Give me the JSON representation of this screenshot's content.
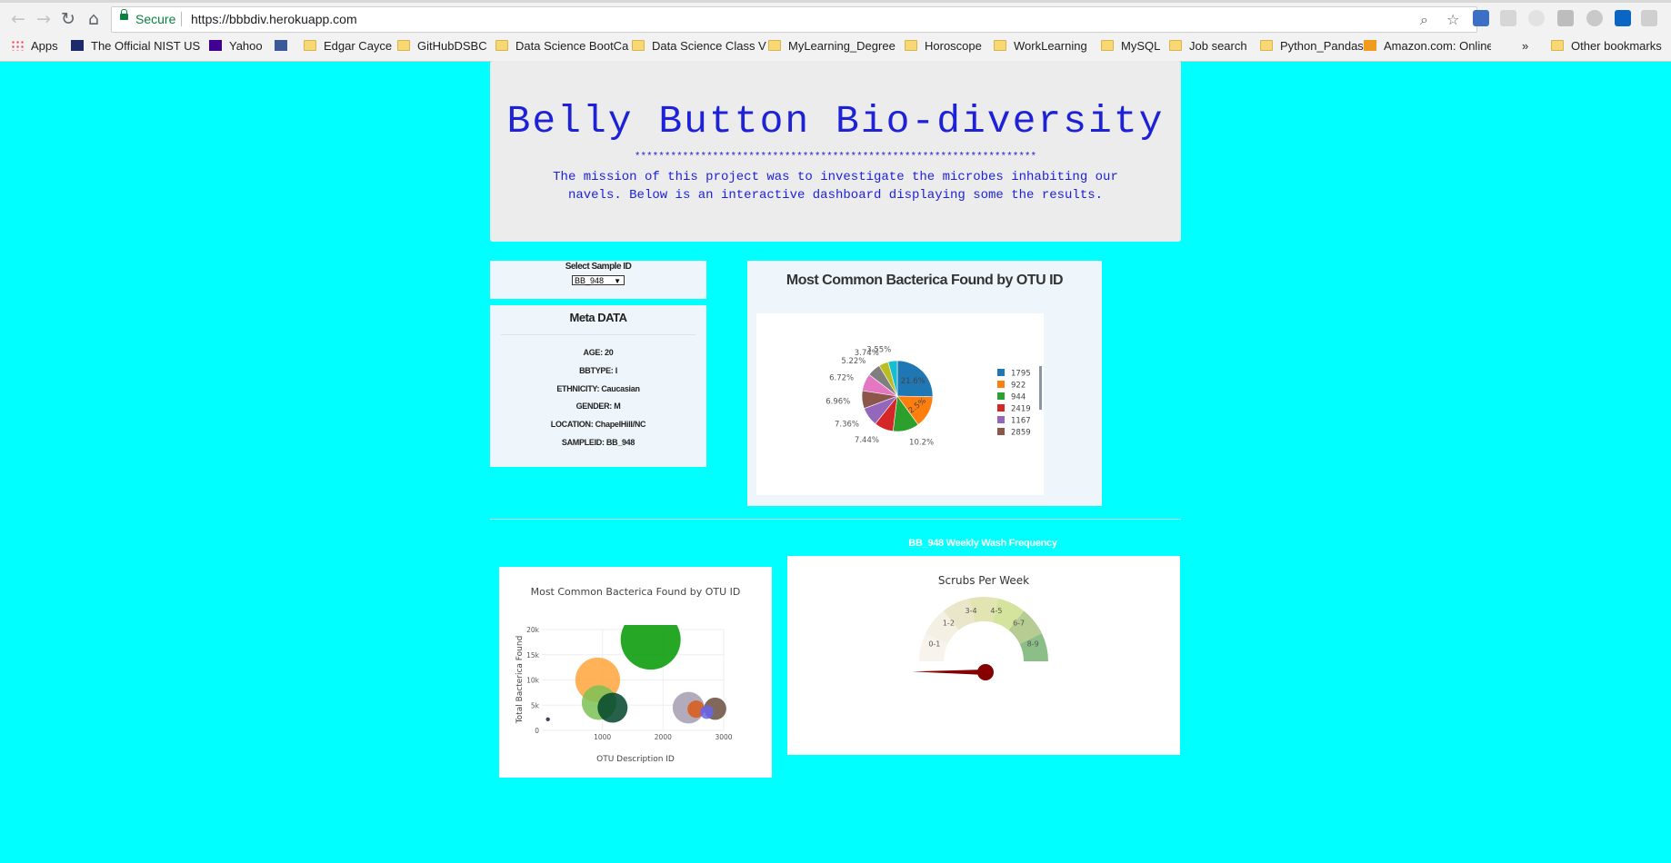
{
  "browser": {
    "secure_label": "Secure",
    "url": "https://bbbdiv.herokuapp.com",
    "bookmarks": [
      {
        "label": "Apps",
        "icon": "apps-grid-icon"
      },
      {
        "label": "The Official NIST US",
        "icon": "nist-icon"
      },
      {
        "label": "Yahoo",
        "icon": "yahoo-icon"
      },
      {
        "label": "",
        "icon": "facebook-icon"
      },
      {
        "label": "Edgar Cayce",
        "icon": "folder-icon"
      },
      {
        "label": "GitHubDSBC",
        "icon": "folder-icon"
      },
      {
        "label": "Data Science BootCa",
        "icon": "folder-icon"
      },
      {
        "label": "Data Science Class V",
        "icon": "folder-icon"
      },
      {
        "label": "MyLearning_Degree",
        "icon": "folder-icon"
      },
      {
        "label": "Horoscope",
        "icon": "folder-icon"
      },
      {
        "label": "WorkLearning",
        "icon": "folder-icon"
      },
      {
        "label": "MySQL",
        "icon": "folder-icon"
      },
      {
        "label": "Job search",
        "icon": "folder-icon"
      },
      {
        "label": "Python_Pandas",
        "icon": "folder-icon"
      },
      {
        "label": "Amazon.com: Online",
        "icon": "amazon-icon"
      }
    ],
    "overflow_label": "»",
    "other_bookmarks": "Other bookmarks"
  },
  "header": {
    "title": "Belly Button Bio-diversity",
    "stars": "*******************************************************************",
    "mission": "The mission of this project was to investigate the microbes inhabiting our navels. Below is an interactive dashboard displaying some the results."
  },
  "selector": {
    "label": "Select Sample ID",
    "value": "BB_948"
  },
  "metadata": {
    "title": "Meta DATA",
    "rows": [
      "AGE: 20",
      "BBTYPE: I",
      "ETHNICITY: Caucasian",
      "GENDER: M",
      "LOCATION: ChapelHill/NC",
      "SAMPLEID: BB_948"
    ]
  },
  "pie_panel": {
    "title": "Most Common Bacterica Found by OTU ID"
  },
  "gauge_caption": "BB_948 Weekly Wash Frequency",
  "colors": {
    "background": "#00ffff",
    "title_blue": "#1e22d6",
    "gauge_needle": "#850000"
  },
  "chart_data": [
    {
      "type": "pie",
      "title": "",
      "labels": [
        "1795",
        "922",
        "944",
        "2419",
        "1167",
        "2859",
        "",
        "",
        "",
        ""
      ],
      "legend_visible": [
        "1795",
        "922",
        "944",
        "2419",
        "1167",
        "2859"
      ],
      "legend_placement": "right",
      "values": [
        21.6,
        12.5,
        10.2,
        7.44,
        7.36,
        6.96,
        6.72,
        5.22,
        3.74,
        3.55
      ],
      "slice_labels": [
        "21.6%",
        "12.5%",
        "10.2%",
        "7.44%",
        "7.36%",
        "6.96%",
        "6.72%",
        "5.22%",
        "3.74%",
        "3.55%"
      ],
      "colors": [
        "#1f77b4",
        "#ff7f0e",
        "#2ca02c",
        "#d62728",
        "#9467bd",
        "#8c564b",
        "#e377c2",
        "#7f7f7f",
        "#bcbd22",
        "#17becf"
      ]
    },
    {
      "type": "scatter",
      "title": "Most Common Bacterica Found by OTU ID",
      "xlabel": "OTU Description ID",
      "ylabel": "Total Bacterica Found",
      "xlim": [
        0,
        3000
      ],
      "ylim": [
        0,
        20000
      ],
      "xticks": [
        "1000",
        "2000",
        "3000"
      ],
      "yticks": [
        "0",
        "5k",
        "10k",
        "15k",
        "20k"
      ],
      "points": [
        {
          "x": 1795,
          "y": 18000,
          "r": 18000,
          "color": "#009900"
        },
        {
          "x": 922,
          "y": 10000,
          "r": 10000,
          "color": "#ffa53a"
        },
        {
          "x": 944,
          "y": 5500,
          "r": 6000,
          "color": "#7cc155"
        },
        {
          "x": 1167,
          "y": 4500,
          "r": 4500,
          "color": "#02452c"
        },
        {
          "x": 2419,
          "y": 4500,
          "r": 5000,
          "color": "#a49cb0"
        },
        {
          "x": 2546,
          "y": 4200,
          "r": 1500,
          "color": "#d95a16"
        },
        {
          "x": 2859,
          "y": 4300,
          "r": 2500,
          "color": "#6a4f3e"
        },
        {
          "x": 2722,
          "y": 3600,
          "r": 900,
          "color": "#6666ee"
        },
        {
          "x": 100,
          "y": 2200,
          "r": 80,
          "color": "#222244"
        }
      ]
    },
    {
      "type": "gauge",
      "title": "Scrubs Per Week",
      "sections": [
        "0-1",
        "1-2",
        "3-4",
        "4-5",
        "6-7",
        "8-9"
      ],
      "section_colors": [
        "#f8f3ec",
        "#f4f1e4",
        "#e9e6c9",
        "#e2e4b1",
        "#d5e49d",
        "#b7cc92",
        "#8cbf88"
      ],
      "range": [
        0,
        9
      ],
      "value": 0.5
    }
  ]
}
